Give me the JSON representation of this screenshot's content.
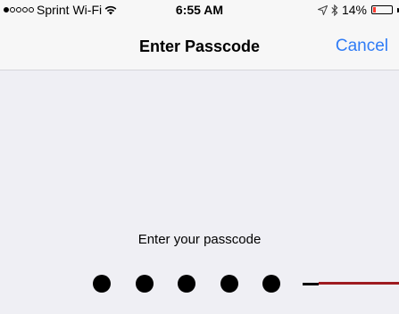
{
  "status_bar": {
    "carrier": "Sprint Wi-Fi",
    "signal_bars_total": 5,
    "signal_bars_filled": 1,
    "time": "6:55 AM",
    "battery_percent_label": "14%",
    "battery_level": 0.14,
    "battery_color": "#ff3b30",
    "icons": [
      "wifi-icon",
      "location-icon",
      "bluetooth-icon",
      "battery-icon"
    ]
  },
  "nav": {
    "title": "Enter Passcode",
    "cancel_label": "Cancel",
    "accent_color": "#2f7cf6"
  },
  "passcode": {
    "prompt": "Enter your passcode",
    "entered_digits": 5,
    "cursor_color": "#9e1b20"
  }
}
